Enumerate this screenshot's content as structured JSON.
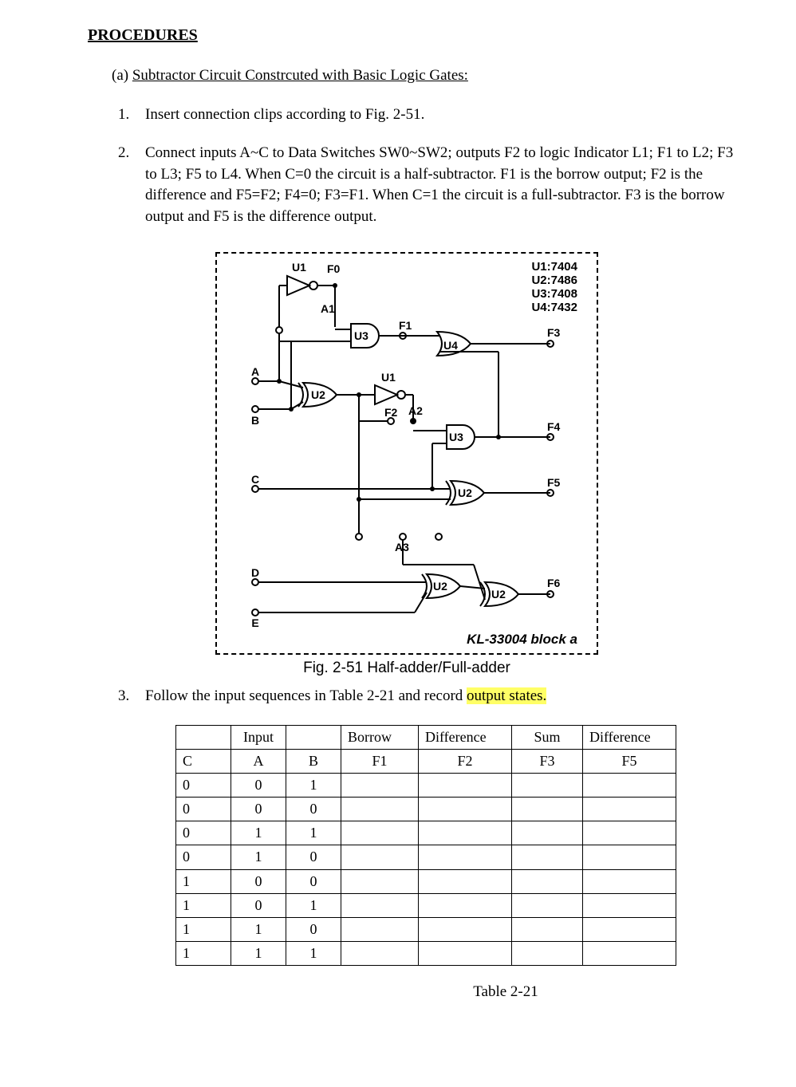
{
  "heading": "PROCEDURES",
  "section": {
    "letter": "(a)",
    "title": "Subtractor Circuit Constrcuted with Basic Logic Gates:"
  },
  "steps": {
    "s1": {
      "num": "1.",
      "text": "Insert connection clips according to Fig. 2-51."
    },
    "s2": {
      "num": "2.",
      "text": "Connect inputs A~C to Data Switches SW0~SW2; outputs F2 to logic Indicator L1; F1 to L2; F3 to L3; F5 to L4. When C=0 the circuit is a half-subtractor. F1 is the borrow output; F2 is the difference and F5=F2; F4=0; F3=F1. When C=1 the circuit is a full-subtractor. F3 is the borrow output and F5 is the difference output."
    },
    "s3": {
      "num": "3.",
      "text_pre": "Follow the input sequences in Table 2-21 and record ",
      "highlight": "output states.",
      "text_post": ""
    }
  },
  "figure": {
    "caption": "Fig. 2-51 Half-adder/Full-adder",
    "block_label": "KL-33004 block a",
    "ic_lines": {
      "l1": "U1:7404",
      "l2": "U2:7486",
      "l3": "U3:7408",
      "l4": "U4:7432"
    },
    "labels": {
      "U1a": "U1",
      "F0": "F0",
      "A1": "A1",
      "U3a": "U3",
      "F1": "F1",
      "U4": "U4",
      "F3": "F3",
      "A": "A",
      "B": "B",
      "U2a": "U2",
      "U1b": "U1",
      "F2": "F2",
      "A2": "A2",
      "U3b": "U3",
      "F4": "F4",
      "C": "C",
      "U2b": "U2",
      "F5": "F5",
      "A3": "A3",
      "D": "D",
      "E": "E",
      "U2c": "U2",
      "U2d": "U2",
      "F6": "F6"
    }
  },
  "table": {
    "header": {
      "input": "Input",
      "borrow": "Borrow",
      "diff": "Difference",
      "sum": "Sum",
      "diff2": "Difference",
      "C": "C",
      "A": "A",
      "B": "B",
      "F1": "F1",
      "F2": "F2",
      "F3": "F3",
      "F5": "F5"
    },
    "rows": [
      {
        "c": "0",
        "a": "0",
        "b": "1"
      },
      {
        "c": "0",
        "a": "0",
        "b": "0"
      },
      {
        "c": "0",
        "a": "1",
        "b": "1"
      },
      {
        "c": "0",
        "a": "1",
        "b": "0"
      },
      {
        "c": "1",
        "a": "0",
        "b": "0"
      },
      {
        "c": "1",
        "a": "0",
        "b": "1"
      },
      {
        "c": "1",
        "a": "1",
        "b": "0"
      },
      {
        "c": "1",
        "a": "1",
        "b": "1"
      }
    ],
    "caption": "Table 2-21"
  }
}
